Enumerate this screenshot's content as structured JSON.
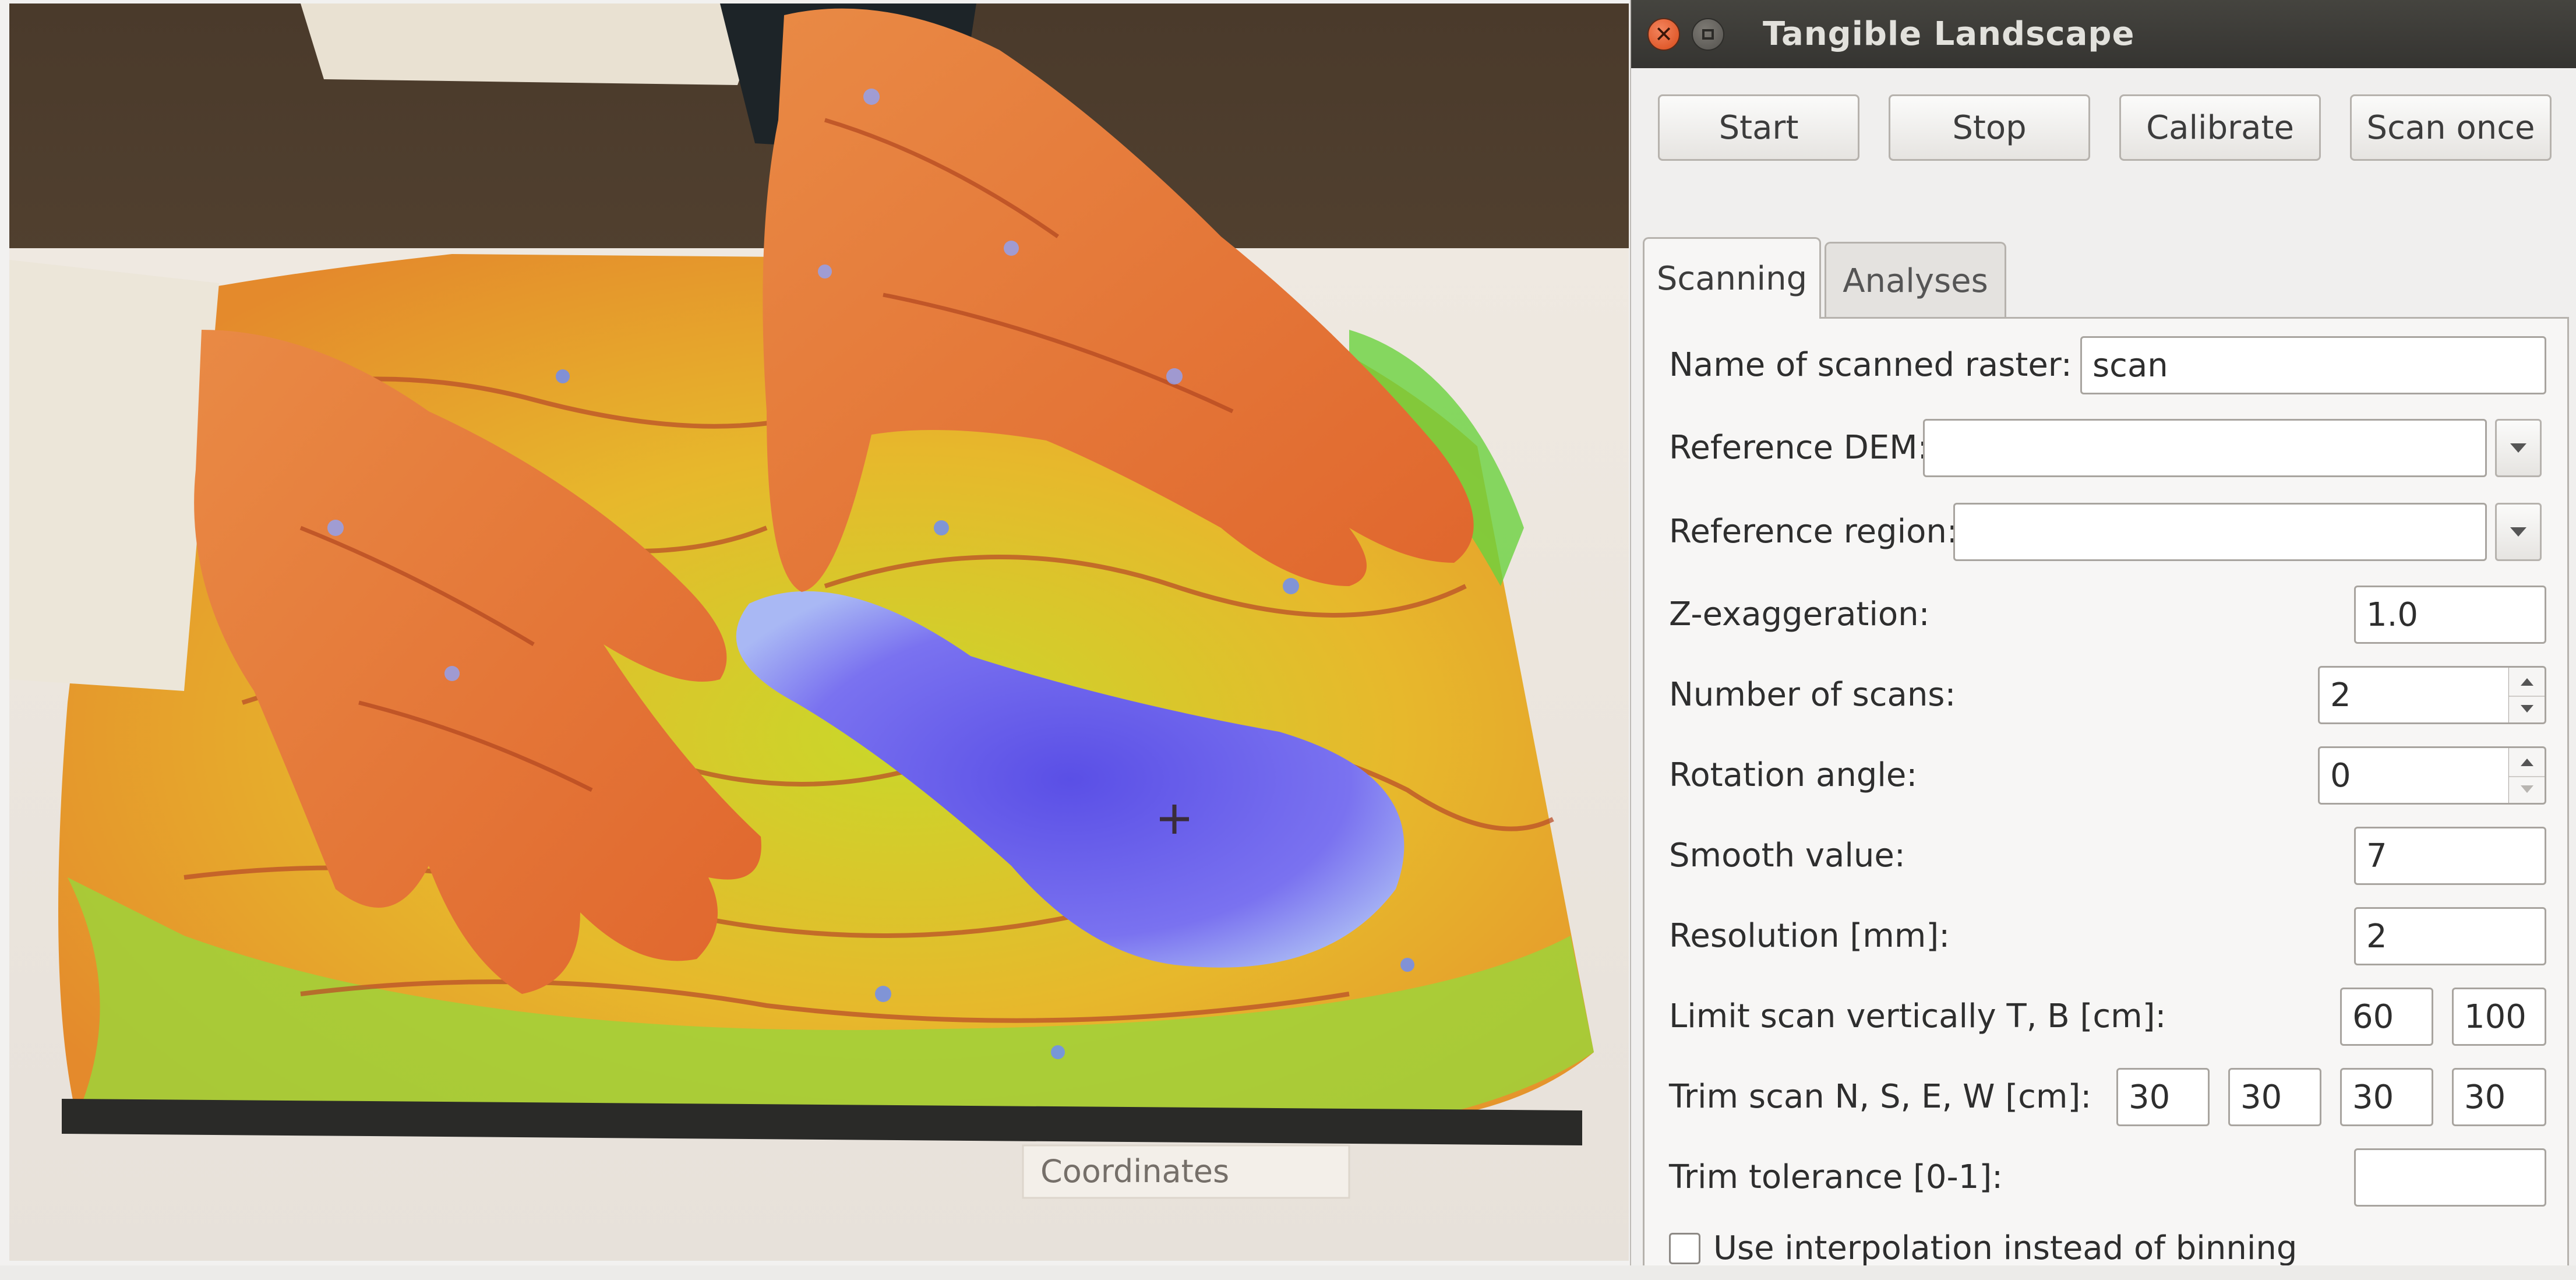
{
  "photo": {
    "description_icon": "sand-model-photo",
    "coordinates_label": "Coordinates"
  },
  "window": {
    "title": "Tangible Landscape",
    "close_icon": "close-icon",
    "maximize_icon": "maximize-icon"
  },
  "toolbar": {
    "start": "Start",
    "stop": "Stop",
    "calibrate": "Calibrate",
    "scan_once": "Scan once"
  },
  "tabs": [
    "Scanning",
    "Analyses"
  ],
  "active_tab": "Scanning",
  "form": {
    "name_label": "Name of scanned raster:",
    "name_value": "scan",
    "ref_dem_label": "Reference DEM:",
    "ref_dem_value": "",
    "ref_region_label": "Reference region:",
    "ref_region_value": "",
    "zexag_label": "Z-exaggeration:",
    "zexag_value": "1.0",
    "nscans_label": "Number of scans:",
    "nscans_value": "2",
    "rotation_label": "Rotation angle:",
    "rotation_value": "0",
    "smooth_label": "Smooth value:",
    "smooth_value": "7",
    "resolution_label": "Resolution [mm]:",
    "resolution_value": "2",
    "limit_label": "Limit scan vertically T, B [cm]:",
    "limit_t": "60",
    "limit_b": "100",
    "trim_label": "Trim scan N, S, E, W [cm]:",
    "trim_n": "30",
    "trim_s": "30",
    "trim_e": "30",
    "trim_w": "30",
    "tolerance_label": "Trim tolerance [0-1]:",
    "tolerance_value": "",
    "interp_label": "Use interpolation instead of binning",
    "interp_checked": false
  },
  "colors": {
    "titlebar": "#3c3b37",
    "close": "#e2581f",
    "panel": "#f7f6f5",
    "water": "#6c63f0",
    "terrain_low": "#d9d31a",
    "terrain_high": "#e0882a"
  }
}
